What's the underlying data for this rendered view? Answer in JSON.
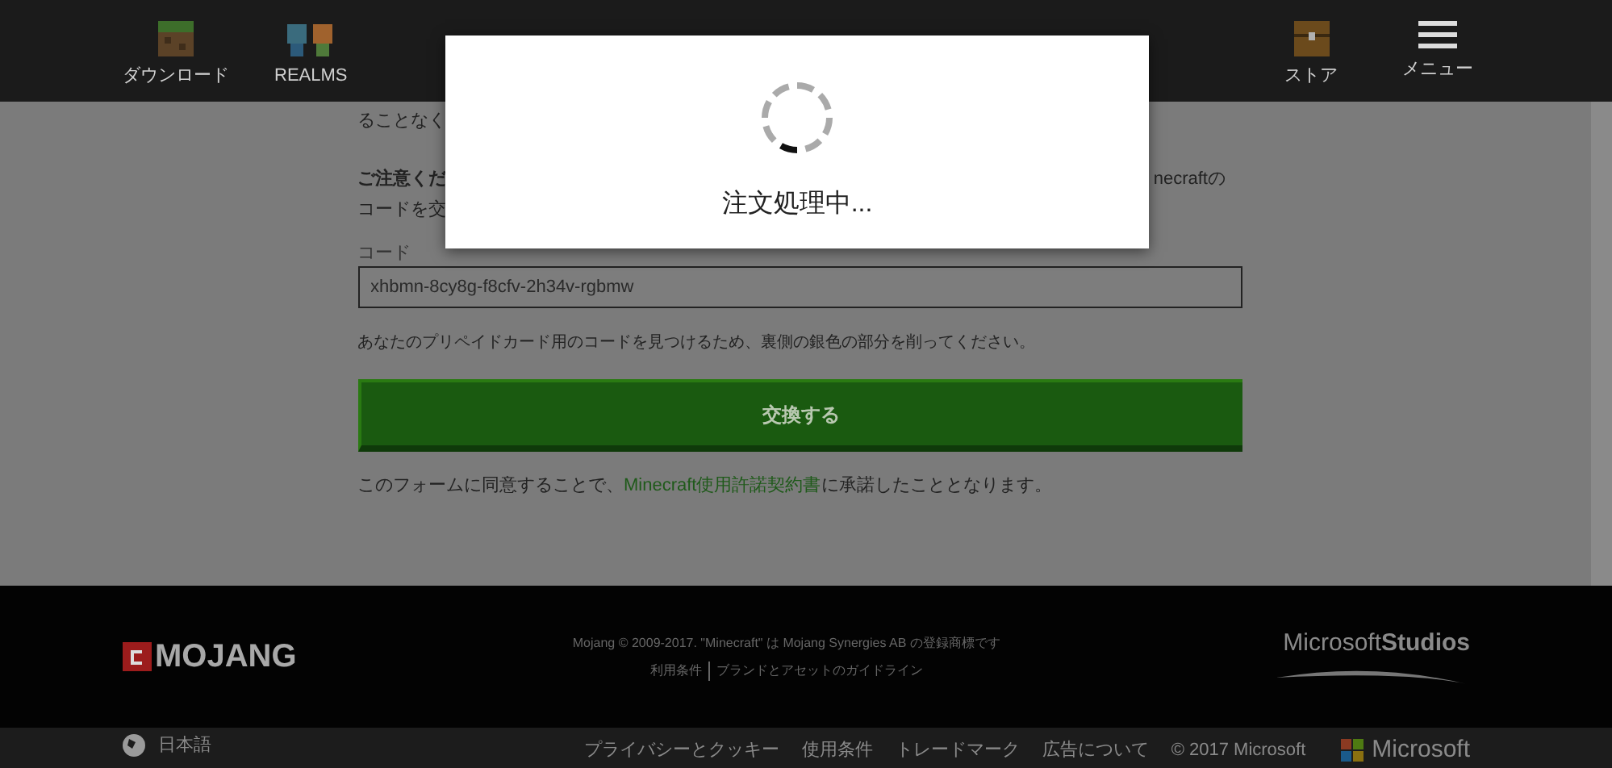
{
  "header": {
    "nav_left": [
      {
        "label": "ダウンロード",
        "kind": "grass"
      },
      {
        "label": "REALMS",
        "kind": "people"
      }
    ],
    "nav_right": [
      {
        "label": "ストア",
        "kind": "chest"
      },
      {
        "label": "メニュー",
        "kind": "menu"
      }
    ]
  },
  "content": {
    "intro_fragment": "ることなく",
    "notice_left": "ご注意くだ",
    "notice_right": "necraftの",
    "notice_line2": "コードを交",
    "code_label": "コード",
    "code_value": "xhbmn-8cy8g-f8cfv-2h34v-rgbmw",
    "hint": "あなたのプリペイドカード用のコードを見つけるため、裏側の銀色の部分を削ってください。",
    "redeem_button": "交換する",
    "agreement_before": "このフォームに同意することで、",
    "agreement_link": "Minecraft使用許諾契約書",
    "agreement_after": "に承諾したこととなります。"
  },
  "modal": {
    "message": "注文処理中..."
  },
  "footer": {
    "brand": "MOJANG",
    "copyright": "Mojang © 2009-2017. \"Minecraft\" は Mojang Synergies AB の登録商標です",
    "links": [
      "利用条件",
      "ブランドとアセットのガイドライン"
    ],
    "studio_left": "Microsoft",
    "studio_right": "Studios"
  },
  "bottom_bar": {
    "language": "日本語",
    "links": [
      "プライバシーとクッキー",
      "使用条件",
      "トレードマーク",
      "広告について"
    ],
    "copyright": "© 2017 Microsoft",
    "brand": "Microsoft"
  }
}
